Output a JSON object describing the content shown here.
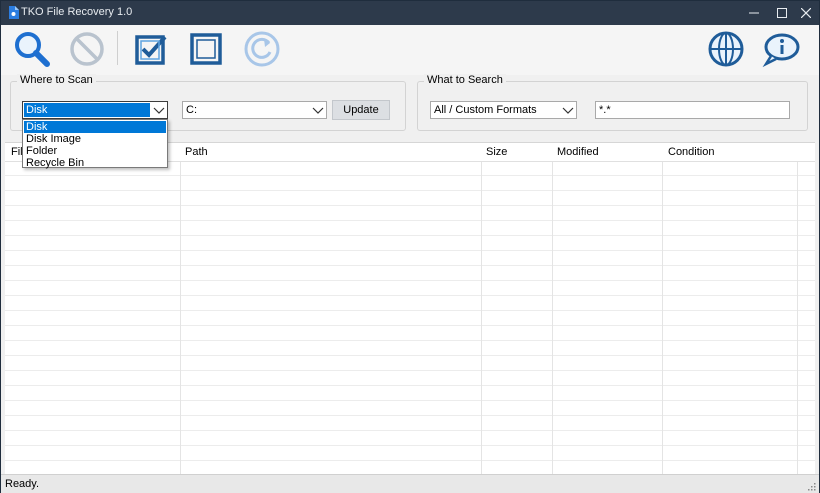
{
  "window": {
    "title": "TKO File Recovery 1.0",
    "controls": {
      "minimize": "—",
      "maximize": "☐",
      "close": "✕"
    }
  },
  "toolbar": {
    "icons": [
      "search-icon",
      "stop-icon",
      "select-all-icon",
      "deselect-icon",
      "recover-icon",
      "language-icon",
      "about-icon"
    ]
  },
  "where_to_scan": {
    "legend": "Where to Scan",
    "source_combo": {
      "value": "Disk",
      "options": [
        "Disk",
        "Disk Image",
        "Folder",
        "Recycle Bin"
      ]
    },
    "drive_combo": {
      "value": "C:"
    },
    "update_label": "Update"
  },
  "what_to_search": {
    "legend": "What to Search",
    "format_combo": {
      "value": "All / Custom Formats"
    },
    "pattern": "*.*"
  },
  "table": {
    "columns": [
      "File",
      "Path",
      "Size",
      "Modified",
      "Condition"
    ],
    "first_column_visible": "Fil"
  },
  "status": {
    "text": "Ready."
  },
  "colors": {
    "titlebar": "#2d3a4b",
    "accent": "#0078d7",
    "icon_blue": "#1e6fd0"
  }
}
